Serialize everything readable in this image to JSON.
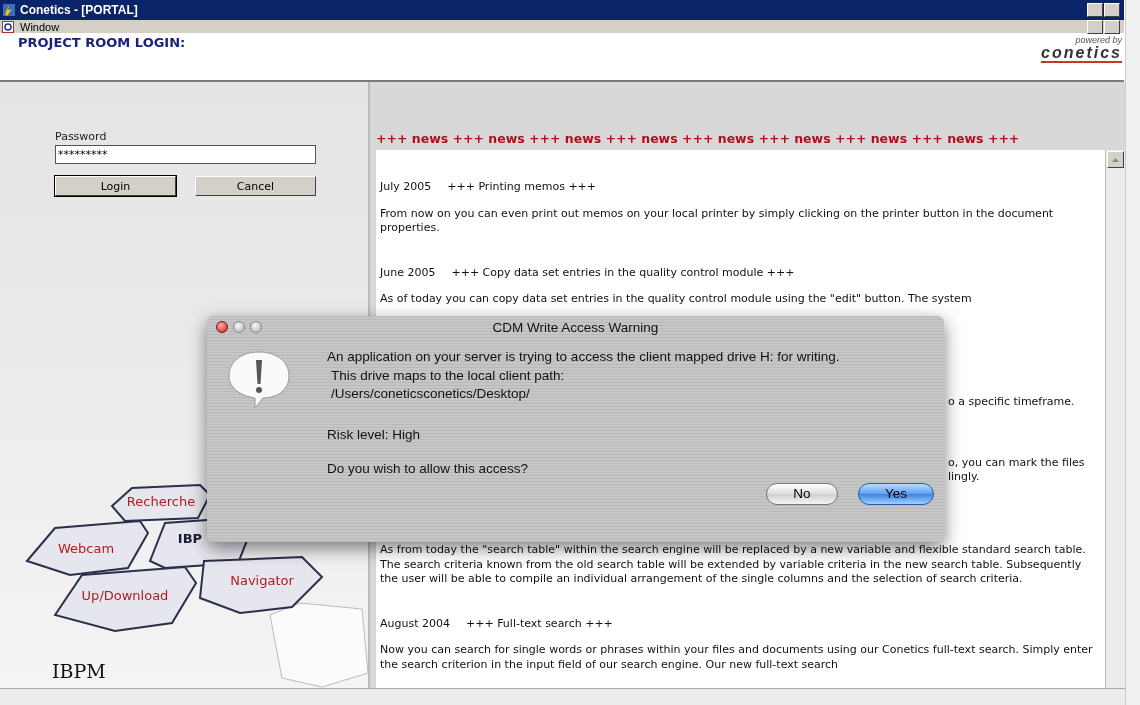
{
  "window": {
    "title": "Conetics - [PORTAL]"
  },
  "menu": [
    {
      "label": "Window"
    }
  ],
  "header": {
    "title": "PROJECT ROOM LOGIN:",
    "logo_tagline": "powered by",
    "logo_name": "conetics"
  },
  "login": {
    "label": "Password",
    "value": "*********",
    "buttons": [
      "Login",
      "Cancel"
    ]
  },
  "nav_tiles": [
    {
      "label": "Recherche"
    },
    {
      "label": "Webcam"
    },
    {
      "label": "IBP"
    },
    {
      "label": "Up/Download"
    },
    {
      "label": "Navigator"
    }
  ],
  "brand": "IBPM",
  "news_banner": "+++  news +++ news +++ news +++ news +++ news +++ news +++ news +++ news +++",
  "news": [
    {
      "kind": "entry",
      "date": "July 2005",
      "title": "+++ Printing memos +++",
      "body": "From now on you can even print out memos on your local printer by simply clicking on the printer button in the document properties."
    },
    {
      "kind": "entry",
      "date": "June 2005",
      "title": "+++ Copy data set entries in the quality control module +++",
      "body": "As of today you can copy data set entries in the quality control module using the \"edit\" button. The system"
    },
    {
      "kind": "fragments",
      "lines": [
        "o a specific timeframe.",
        "o, you can mark the files",
        "lingly."
      ]
    },
    {
      "kind": "text",
      "body": "As from today the \"search table\" within the search engine will be replaced by a new variable and flexible standard search table. The search criteria known from the old search table will be extended by variable criteria in the new search table. Subsequently the user will be able to compile an individual arrangement of the single columns and the selection of search criteria."
    },
    {
      "kind": "entry",
      "date": "August 2004",
      "title": "+++ Full-text search +++",
      "body": "Now you can search for single words or phrases within your files and documents using our Conetics full-text search. Simply enter the search criterion in the input field of our search engine. Our new full-text search"
    }
  ],
  "dialog": {
    "title": "CDM Write Access Warning",
    "lines": [
      "An application on your server is trying to access the client mapped drive H: for writing.",
      "This drive maps to the local client path:",
      "/Users/coneticsconetics/Desktop/"
    ],
    "risk": "Risk level: High",
    "question": "Do you wish to allow this access?",
    "buttons": [
      {
        "label": "No",
        "default": false
      },
      {
        "label": "Yes",
        "default": true
      }
    ]
  }
}
